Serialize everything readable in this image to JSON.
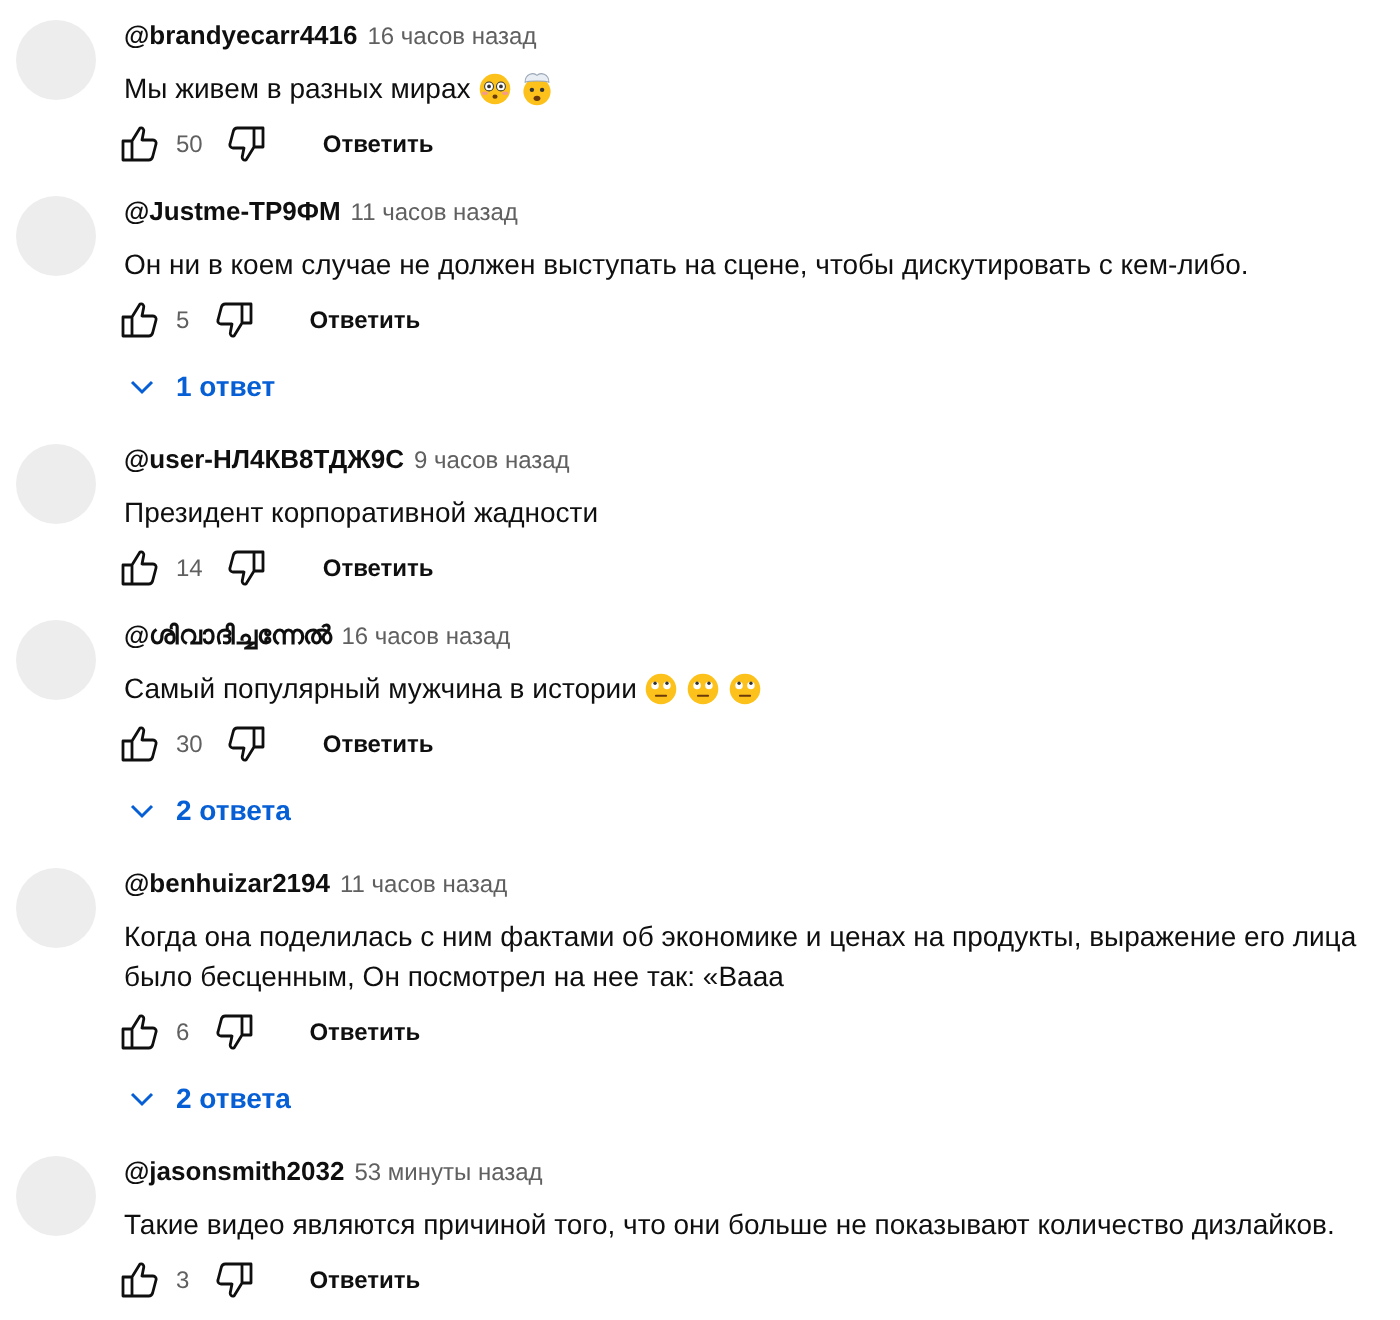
{
  "comments": [
    {
      "author": "@brandyecarr4416",
      "time": "16 часов назад",
      "text": "Мы живем в разных мирах",
      "emoji": [
        {
          "kind": "flushed"
        },
        {
          "kind": "exploding"
        }
      ],
      "likes": "50",
      "reply_label": "Ответить"
    },
    {
      "author": "@Justme-TP9ФМ",
      "time": "11 часов назад",
      "text": "Он ни в коем случае не должен выступать на сцене, чтобы дискутировать с кем-либо.",
      "likes": "5",
      "reply_label": "Ответить",
      "replies": "1 ответ"
    },
    {
      "author": "@user-НЛ4КВ8ТДЖ9С",
      "time": "9 часов назад",
      "text": "Президент корпоративной жадности",
      "likes": "14",
      "reply_label": "Ответить"
    },
    {
      "author": "@ശിവാദിച്ചന്നേൽ",
      "time": "16 часов назад",
      "text": "Самый популярный мужчина в истории",
      "emoji": [
        {
          "kind": "eyeroll"
        },
        {
          "kind": "eyeroll"
        },
        {
          "kind": "eyeroll"
        }
      ],
      "likes": "30",
      "reply_label": "Ответить",
      "replies": "2 ответа"
    },
    {
      "author": "@benhuizar2194",
      "time": "11 часов назад",
      "text": "Когда она поделилась с ним фактами об экономике и ценах на продукты, выражение его лица было бесценным, Он посмотрел на нее так: «Вааа",
      "likes": "6",
      "reply_label": "Ответить",
      "replies": "2 ответа"
    },
    {
      "author": "@jasonsmith2032",
      "time": "53 минуты назад",
      "text": "Такие видео являются причиной того, что они больше не показывают количество дизлайков.",
      "likes": "3",
      "reply_label": "Ответить"
    }
  ]
}
